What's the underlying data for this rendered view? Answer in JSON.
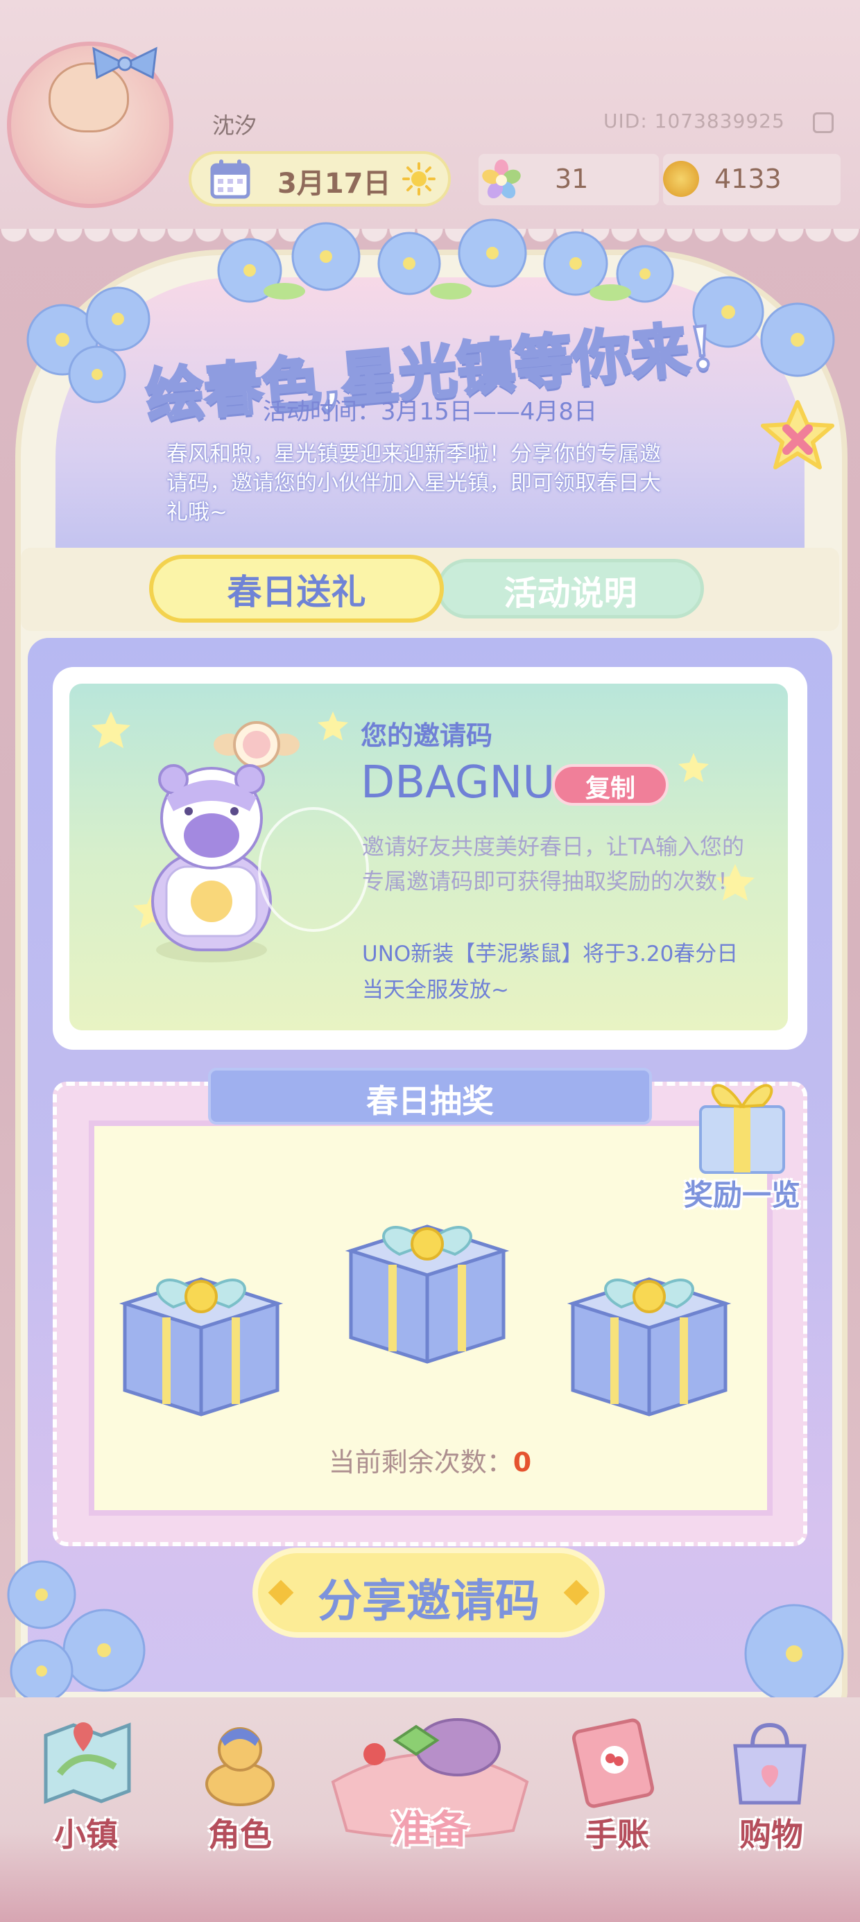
{
  "header": {
    "player_name": "沈汐",
    "uid": "UID: 1073839925",
    "date": "3月17日",
    "flower_count": "31",
    "coin_count": "4133"
  },
  "event": {
    "title": "绘春色,星光镇等你来!",
    "time": "活动时间：3月15日——4月8日",
    "intro": "春风和煦，星光镇要迎来迎新季啦！分享你的专属邀请码，邀请您的小伙伴加入星光镇，即可领取春日大礼哦~"
  },
  "tabs": {
    "spring_gift": "春日送礼",
    "event_info": "活动说明"
  },
  "invite": {
    "label": "您的邀请码",
    "code": "DBAGNU",
    "copy_label": "复制",
    "description": "邀请好友共度美好春日，让TA输入您的专属邀请码即可获得抽取奖励的次数！",
    "uno_note": "UNO新装【芋泥紫鼠】将于3.20春分日当天全服发放~"
  },
  "lottery": {
    "title": "春日抽奖",
    "reward_list_label": "奖励一览",
    "remaining_label": "当前剩余次数：",
    "remaining_count": "0"
  },
  "share_button_label": "分享邀请码",
  "nav": {
    "town": "小镇",
    "character": "角色",
    "prepare": "准备",
    "journal": "手账",
    "shopping": "购物"
  },
  "colors": {
    "accent_blue": "#6f80d6",
    "tab_active": "#fbf4a8",
    "tab_inactive": "#c9ecd9",
    "copy_button": "#f07f99",
    "remaining_count": "#e5532f"
  },
  "icons": [
    "calendar-icon",
    "sun-icon",
    "flower-currency-icon",
    "coin-icon",
    "close-icon",
    "copy-uid-icon",
    "gift-box-icon",
    "map-icon",
    "character-icon",
    "journal-icon",
    "shopping-bag-icon"
  ]
}
